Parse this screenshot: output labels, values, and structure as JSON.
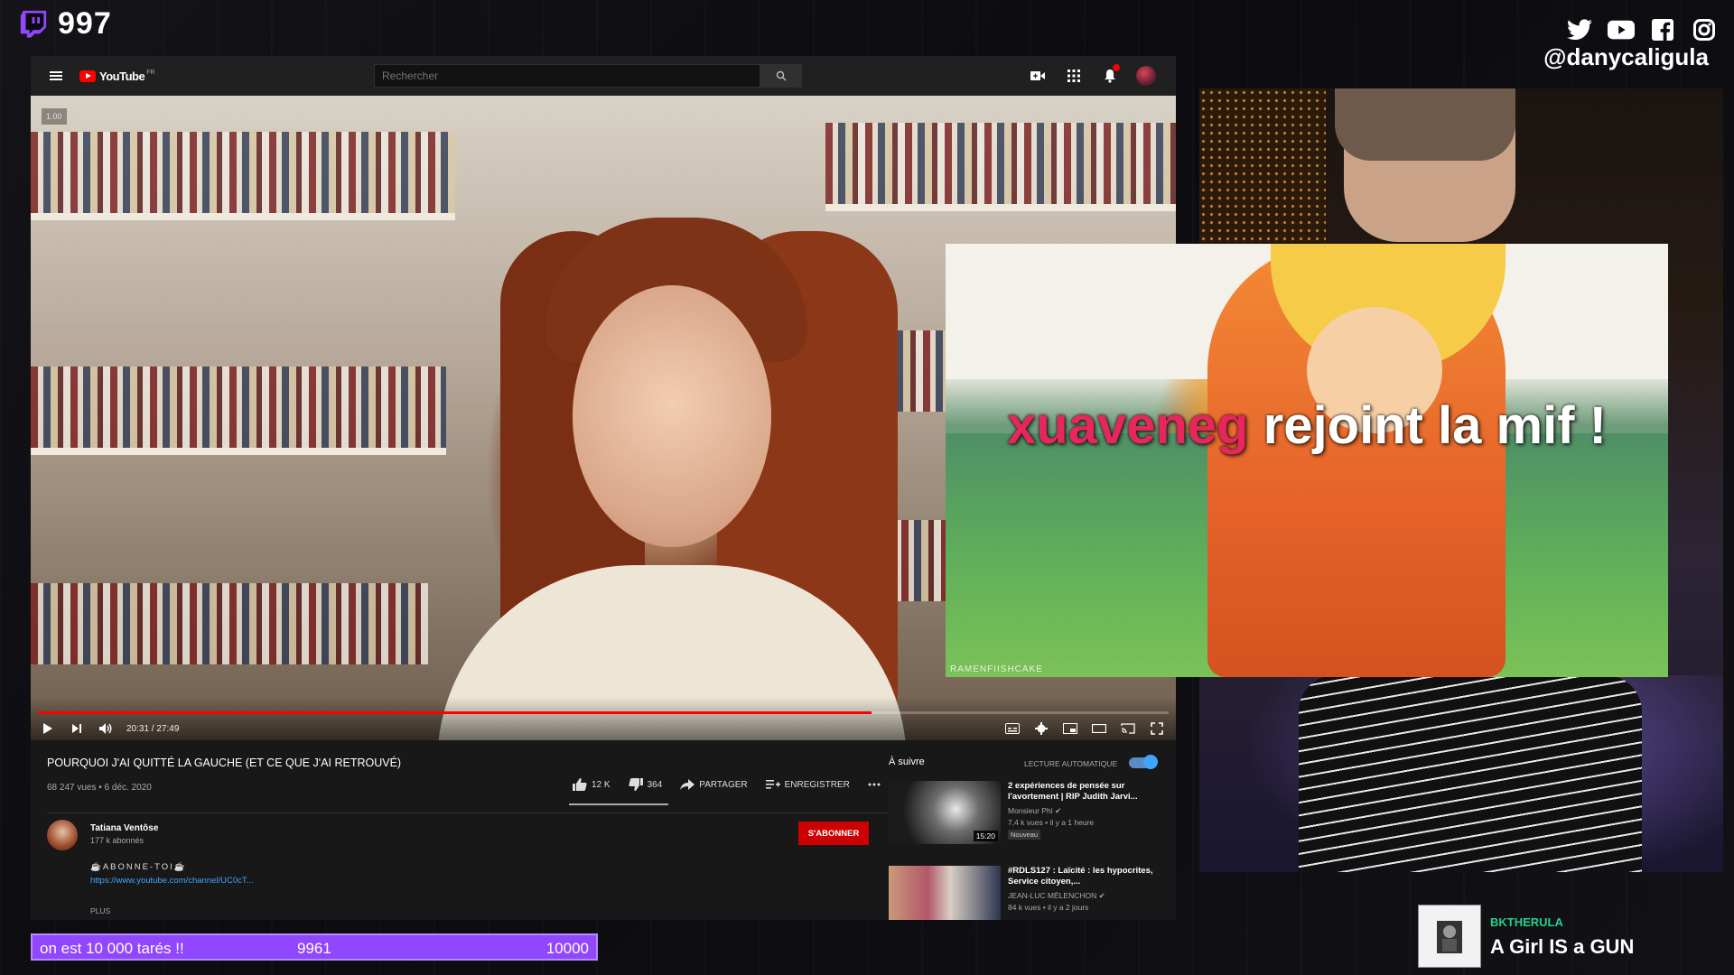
{
  "overlay": {
    "viewer_count": "997",
    "handle": "@danycaligula",
    "socials": [
      "twitter-icon",
      "youtube-icon",
      "facebook-icon",
      "instagram-icon"
    ],
    "accent": "#9146ff"
  },
  "youtube": {
    "logo_text": "YouTube",
    "logo_region": "FR",
    "search_placeholder": "Rechercher",
    "video": {
      "quality": "1.00",
      "time": "20:31 / 27:49",
      "progress": 0.7376,
      "title": "POURQUOI J'AI QUITTÉ LA GAUCHE (ET CE QUE J'AI RETROUVÉ)",
      "views": "68 247 vues • 6 déc. 2020",
      "likes": "12 K",
      "dislikes": "364",
      "share": "PARTAGER",
      "save": "ENREGISTRER"
    },
    "channel": {
      "name": "Tatiana Ventôse",
      "subs": "177 k abonnés",
      "subscribe": "S'ABONNER",
      "desc_line": "☕ABONNE-TOI☕",
      "link": "https://www.youtube.com/channel/UC0cT...",
      "more": "PLUS"
    },
    "sidebar": {
      "up_next": "À suivre",
      "autoplay": "LECTURE AUTOMATIQUE",
      "items": [
        {
          "title": "2 expériences de pensée sur l'avortement | RIP Judith Jarvi...",
          "channel": "Monsieur Phi ✔",
          "stats": "7,4 k vues • il y a 1 heure",
          "badge": "Nouveau",
          "duration": "15:20"
        },
        {
          "title": "#RDLS127 : Laïcité : les hypocrites, Service citoyen,...",
          "channel": "JEAN-LUC MÉLENCHON ✔",
          "stats": "84 k vues • il y a 2 jours",
          "badge": "",
          "duration": ""
        }
      ]
    }
  },
  "alert": {
    "username": "xuaveneg",
    "message": "rejoint la mif !",
    "watermark": "RAMENFIISHCAKE",
    "username_color": "#e6265c"
  },
  "goal": {
    "label": "on est 10 000 tarés !!",
    "current": "9961",
    "target": "10000",
    "current_value": 9961,
    "target_value": 10000
  },
  "now_playing": {
    "artist": "BKTHERULA",
    "title": "A Girl IS a GUN"
  }
}
